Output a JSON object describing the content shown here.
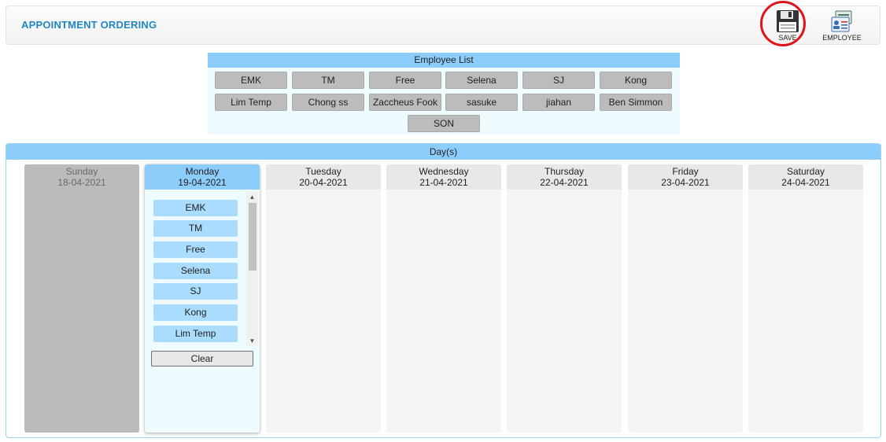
{
  "header": {
    "title": "APPOINTMENT ORDERING",
    "save_label": "SAVE",
    "employee_label": "EMPLOYEE"
  },
  "employee_list": {
    "title": "Employee List",
    "employees": [
      "EMK",
      "TM",
      "Free",
      "Selena",
      "SJ",
      "Kong",
      "Lim Temp",
      "Chong ss",
      "Zaccheus Fook",
      "sasuke",
      "jiahan",
      "Ben Simmon",
      "SON"
    ]
  },
  "days": {
    "title": "Day(s)",
    "columns": [
      {
        "name": "Sunday",
        "date": "18-04-2021",
        "state": "disabled"
      },
      {
        "name": "Monday",
        "date": "19-04-2021",
        "state": "active"
      },
      {
        "name": "Tuesday",
        "date": "20-04-2021",
        "state": "normal"
      },
      {
        "name": "Wednesday",
        "date": "21-04-2021",
        "state": "normal"
      },
      {
        "name": "Thursday",
        "date": "22-04-2021",
        "state": "normal"
      },
      {
        "name": "Friday",
        "date": "23-04-2021",
        "state": "normal"
      },
      {
        "name": "Saturday",
        "date": "24-04-2021",
        "state": "normal"
      }
    ],
    "monday_assigned": [
      "EMK",
      "TM",
      "Free",
      "Selena",
      "SJ",
      "Kong",
      "Lim Temp"
    ],
    "clear_label": "Clear"
  },
  "colors": {
    "title_blue": "#1f86c2",
    "header_blue": "#8ccdfb",
    "chip_gray": "#bcbcbc",
    "assigned_blue": "#a9dcfd",
    "highlight_red": "#e0141b"
  }
}
